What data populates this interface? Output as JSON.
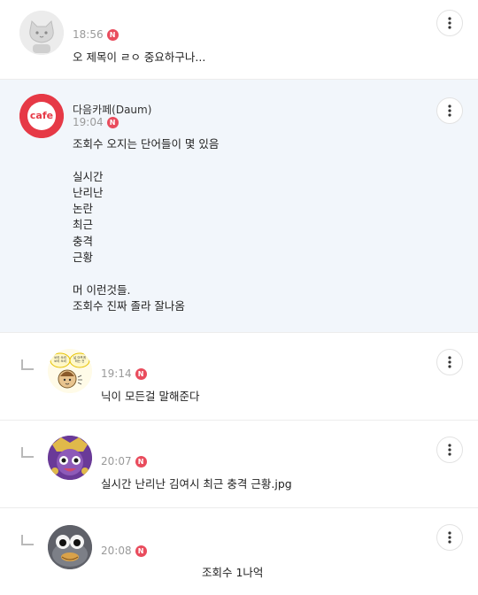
{
  "comments": [
    {
      "time": "18:56",
      "badge": "N",
      "text": "오 제목이 ㄹㅇ 중요하구나..."
    },
    {
      "author": "다음카페(Daum)",
      "time": "19:04",
      "badge": "N",
      "logo_text": "cafe",
      "text": "조회수 오지는 단어들이 몇 있음\n\n실시간\n난리난\n논란\n최근\n충격\n근황\n\n머 이런것들.\n조회수 진짜 졸라 잘나옴"
    },
    {
      "time": "19:14",
      "badge": "N",
      "text": "닉이 모든걸 말해준다",
      "sticker_text_1": "쏘리 쏘리 쏘리 쏘리",
      "sticker_text_2": "날 아프게 하는 건"
    },
    {
      "time": "20:07",
      "badge": "N",
      "text": "실시간 난리난 김여시 최근 충격 근황.jpg"
    },
    {
      "time": "20:08",
      "badge": "N",
      "text": "조회수 1나억"
    }
  ],
  "colors": {
    "highlight_bg": "#f2f6fb",
    "new_badge": "#e94c5d",
    "cafe_logo": "#e63946"
  },
  "icons": {
    "more": "more-vertical-icon",
    "reply": "reply-arrow-icon",
    "new": "new-badge-icon"
  }
}
